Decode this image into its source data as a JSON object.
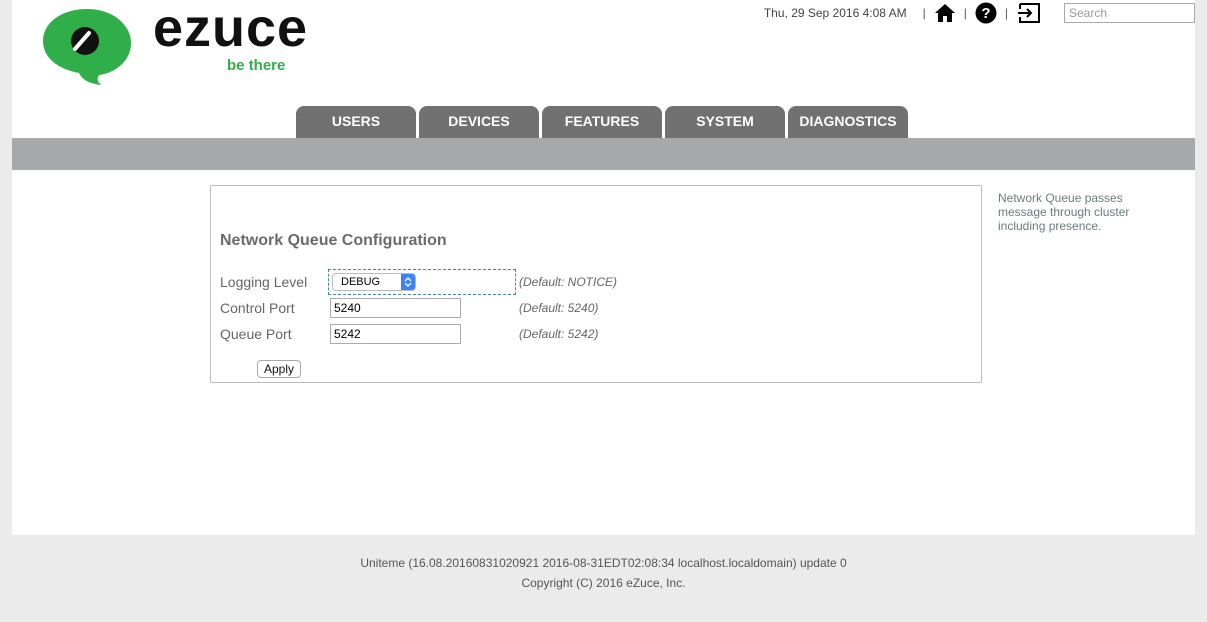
{
  "logo": {
    "word": "ezuce",
    "tagline": "be there"
  },
  "topbar": {
    "datetime": "Thu, 29 Sep 2016 4:08 AM",
    "separator": "|",
    "icons": [
      "home-icon",
      "help-icon",
      "logout-icon"
    ],
    "search_placeholder": "Search"
  },
  "tabs": [
    "USERS",
    "DEVICES",
    "FEATURES",
    "SYSTEM",
    "DIAGNOSTICS"
  ],
  "panel": {
    "title": "Network Queue Configuration",
    "logging_level": {
      "label": "Logging Level",
      "value": "DEBUG",
      "default": "(Default: NOTICE)"
    },
    "control_port": {
      "label": "Control Port",
      "value": "5240",
      "default": "(Default: 5240)"
    },
    "queue_port": {
      "label": "Queue Port",
      "value": "5242",
      "default": "(Default: 5242)"
    },
    "apply_label": "Apply"
  },
  "help_text": "Network Queue passes message through cluster including presence.",
  "footer": {
    "version": "Uniteme (16.08.20160831020921 2016-08-31EDT02:08:34 localhost.localdomain) update 0",
    "copyright": "Copyright (C) 2016 eZuce, Inc."
  },
  "colors": {
    "brand_green": "#2fae4a",
    "tab_bg": "#717171",
    "bar_grey": "#a7a8aa",
    "select_blue": "#3e82f7"
  }
}
